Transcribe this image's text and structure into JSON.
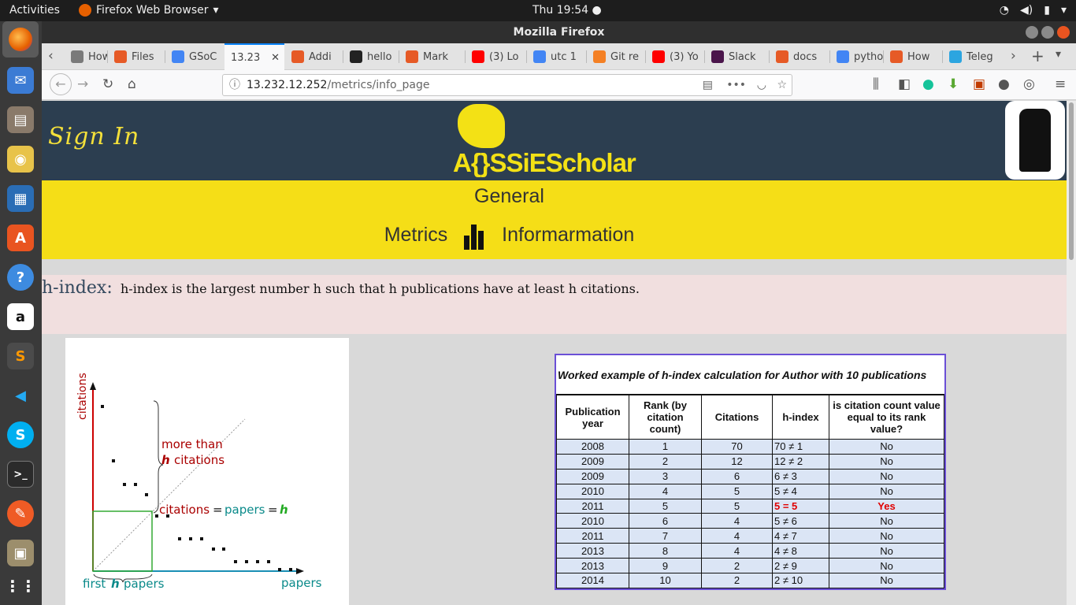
{
  "system": {
    "activities": "Activities",
    "app_name": "Firefox Web Browser",
    "clock": "Thu 19:54 ●"
  },
  "window": {
    "title": "Mozilla Firefox"
  },
  "tabs": [
    {
      "label": "How",
      "color": "#7a7a7a"
    },
    {
      "label": "Files",
      "color": "#e65a26"
    },
    {
      "label": "GSoC",
      "color": "#4285f4"
    },
    {
      "label": "13.23",
      "color": "#ffffff"
    },
    {
      "label": "Addi",
      "color": "#e65a26"
    },
    {
      "label": "hello",
      "color": "#222222"
    },
    {
      "label": "Mark",
      "color": "#e65a26"
    },
    {
      "label": "(3) Lo",
      "color": "#ff0000"
    },
    {
      "label": "utc 1",
      "color": "#4285f4"
    },
    {
      "label": "Git re",
      "color": "#f48024"
    },
    {
      "label": "(3) Yo",
      "color": "#ff0000"
    },
    {
      "label": "Slack",
      "color": "#4a154b"
    },
    {
      "label": "docs",
      "color": "#e65a26"
    },
    {
      "label": "pytho",
      "color": "#4285f4"
    },
    {
      "label": "How",
      "color": "#e65a26"
    },
    {
      "label": "Teleg",
      "color": "#2ca5e0"
    }
  ],
  "url": {
    "host": "13.232.12.252",
    "path": "/metrics/info_page"
  },
  "page": {
    "sign_in": "Sign In",
    "logo_text": "A{}SSiEScholar",
    "heading_line1": "General",
    "heading_metrics": "Metrics",
    "heading_info": "Informarmation",
    "hindex_label": "h-index:",
    "hindex_text": "h-index is the largest number h such that h publications have at least h citations."
  },
  "figure": {
    "y_axis": "citations",
    "x_axis": "papers",
    "more_than": "more than",
    "h_citations": "h citations",
    "citations_eq": "citations",
    "papers_eq": "papers",
    "h": "h",
    "first_h_papers_1": "first",
    "first_h_papers_2": "papers"
  },
  "worked_example": {
    "title": "Worked example of h-index calculation for Author with 10 publications",
    "headers": [
      "Publication year",
      "Rank (by citation count)",
      "Citations",
      "h-index",
      "is citation count value equal to its rank value?"
    ],
    "rows": [
      [
        "2008",
        "1",
        "70",
        "70 ≠ 1",
        "No"
      ],
      [
        "2009",
        "2",
        "12",
        "12 ≠ 2",
        "No"
      ],
      [
        "2009",
        "3",
        "6",
        "6 ≠ 3",
        "No"
      ],
      [
        "2010",
        "4",
        "5",
        "5 ≠ 4",
        "No"
      ],
      [
        "2011",
        "5",
        "5",
        "5 = 5",
        "Yes"
      ],
      [
        "2010",
        "6",
        "4",
        "5 ≠ 6",
        "No"
      ],
      [
        "2011",
        "7",
        "4",
        "4 ≠ 7",
        "No"
      ],
      [
        "2013",
        "8",
        "4",
        "4 ≠ 8",
        "No"
      ],
      [
        "2013",
        "9",
        "2",
        "2 ≠ 9",
        "No"
      ],
      [
        "2014",
        "10",
        "2",
        "2 ≠ 10",
        "No"
      ]
    ],
    "highlight_row": 4,
    "highlight_color": "#e00000"
  },
  "colors": {
    "header_bg": "#2c3e50",
    "brand_yellow": "#f5de17",
    "definition_bg": "#f1dfdf"
  }
}
